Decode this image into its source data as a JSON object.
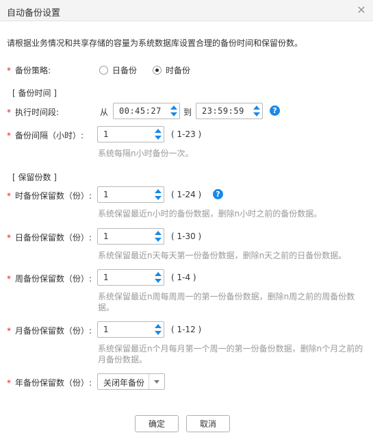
{
  "dialog": {
    "title": "自动备份设置",
    "close": "✕"
  },
  "description": "请根据业务情况和共享存储的容量为系统数据库设置合理的备份时间和保留份数。",
  "policy": {
    "label": "备份策略:",
    "options": [
      "日备份",
      "时备份"
    ],
    "selected": "时备份"
  },
  "sections": {
    "backup_time": "[ 备份时间 ]",
    "retention": "[ 保留份数 ]"
  },
  "exec_time": {
    "label": "执行时间段:",
    "from": "从",
    "start": "00:45:27",
    "to": "到",
    "end": "23:59:59"
  },
  "interval": {
    "label": "备份间隔（小时）:",
    "value": "1",
    "range": "( 1-23 )",
    "hint": "系统每隔n小时备份一次。"
  },
  "hour_keep": {
    "label": "时备份保留数（份）:",
    "value": "1",
    "range": "( 1-24 )",
    "hint": "系统保留最近n小时的备份数据，删除n小时之前的备份数据。"
  },
  "day_keep": {
    "label": "日备份保留数（份）:",
    "value": "1",
    "range": "( 1-30 )",
    "hint": "系统保留最近n天每天第一份备份数据，删除n天之前的日备份数据。"
  },
  "week_keep": {
    "label": "周备份保留数（份）:",
    "value": "1",
    "range": "( 1-4 )",
    "hint": "系统保留最近n周每周周一的第一份备份数据，删除n周之前的周备份数据。"
  },
  "month_keep": {
    "label": "月备份保留数（份）:",
    "value": "1",
    "range": "( 1-12 )",
    "hint": "系统保留最近n个月每月第一个周一的第一份备份数据，删除n个月之前的月备份数据。"
  },
  "year_keep": {
    "label": "年备份保留数（份）:",
    "selected": "关闭年备份"
  },
  "buttons": {
    "ok": "确定",
    "cancel": "取消"
  },
  "colors": {
    "accent": "#1a8ae6",
    "required": "#e02020",
    "hint": "#999999"
  }
}
